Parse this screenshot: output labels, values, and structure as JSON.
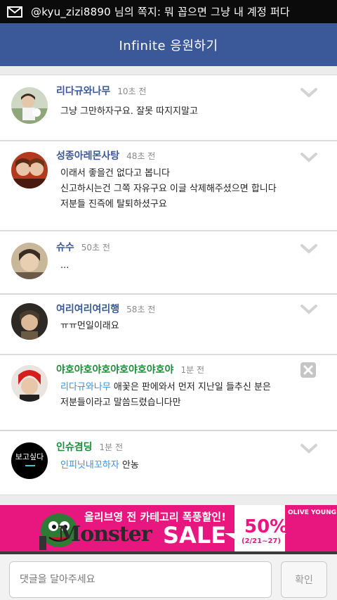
{
  "status": {
    "notification": "@kyu_zizi8890 님의 쪽지: 뭐 꼽으면 그냥 내 계정 퍼다"
  },
  "header": {
    "title": "Infinite 응원하기"
  },
  "comments": [
    {
      "name": "리다규와나무",
      "time": "10초 전",
      "lines": [
        "그냥 그만하자구요. 잘못 따지지말고"
      ]
    },
    {
      "name": "성종아레몬사탕",
      "time": "48초 전",
      "lines": [
        "이래서 좋을건 없다고 봅니다",
        "신고하시는건 그쪽 자유구요 이글 삭제해주셨으면 합니다",
        "저분들 진즉에 탈퇴하셨구요"
      ]
    },
    {
      "name": "슈수",
      "time": "50초 전",
      "lines": [
        "..."
      ]
    },
    {
      "name": "여리여리여리행",
      "time": "58초 전",
      "lines": [
        "ㅠㅠ먼일이래요"
      ]
    },
    {
      "name": "야호야호야호야호야호야호야",
      "time": "1분 전",
      "mention": "리다규와나무",
      "after_mention": " 애꽃은 판에와서 먼저 지난일 들추신 분은",
      "lines": [
        "저분들이라고 말씀드렸습니다만"
      ]
    },
    {
      "name": "인슈겸딩",
      "time": "1분 전",
      "mention": "인피닛내꼬하자",
      "after_mention": " 안농",
      "lines": []
    }
  ],
  "avatars": {
    "a6_text": "보고싶다"
  },
  "banner": {
    "headline": "올리브영 전 카테고리 폭풍할인!",
    "monster": "Monster",
    "sale": "SALE",
    "percent": "50%",
    "dates": "(2/21~27)",
    "brand": "OLIVE YOUNG"
  },
  "composer": {
    "placeholder": "댓글을 달아주세요",
    "submit": "확인"
  },
  "colors": {
    "header": "#3b5998",
    "banner": "#e8177f",
    "name": "#3b5998",
    "mention": "#3b8fd8"
  }
}
